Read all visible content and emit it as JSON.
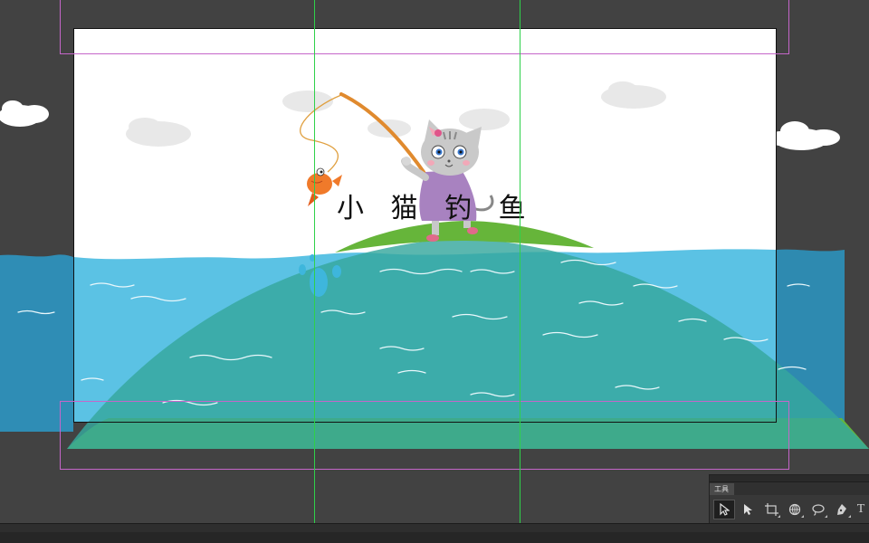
{
  "document": {
    "title_text": "小 猫 钓 鱼"
  },
  "tools_panel": {
    "tab_label": "工具",
    "tools": [
      {
        "name": "selection-tool",
        "icon": "pointer-outline-icon",
        "active": true
      },
      {
        "name": "direct-selection-tool",
        "icon": "pointer-solid-icon",
        "active": false
      },
      {
        "name": "artboard-tool",
        "icon": "artboard-icon",
        "active": false
      },
      {
        "name": "puppet-warp-tool",
        "icon": "globe-icon",
        "active": false
      },
      {
        "name": "lasso-tool",
        "icon": "lasso-icon",
        "active": false
      },
      {
        "name": "pen-tool",
        "icon": "pen-nib-icon",
        "active": false
      },
      {
        "name": "type-tool",
        "icon": "type-icon",
        "active": false
      }
    ],
    "type_tool_glyph": "T"
  },
  "colors": {
    "workspace_bg": "#424242",
    "canvas_bg": "#ffffff",
    "water_light": "#5bc2e4",
    "water_dark": "#2e8ab0",
    "hill_green": "#66b53a",
    "hill_teal": "#3caea6",
    "guide_green": "#2fd14a",
    "safe_area_magenta": "#c566c9"
  }
}
